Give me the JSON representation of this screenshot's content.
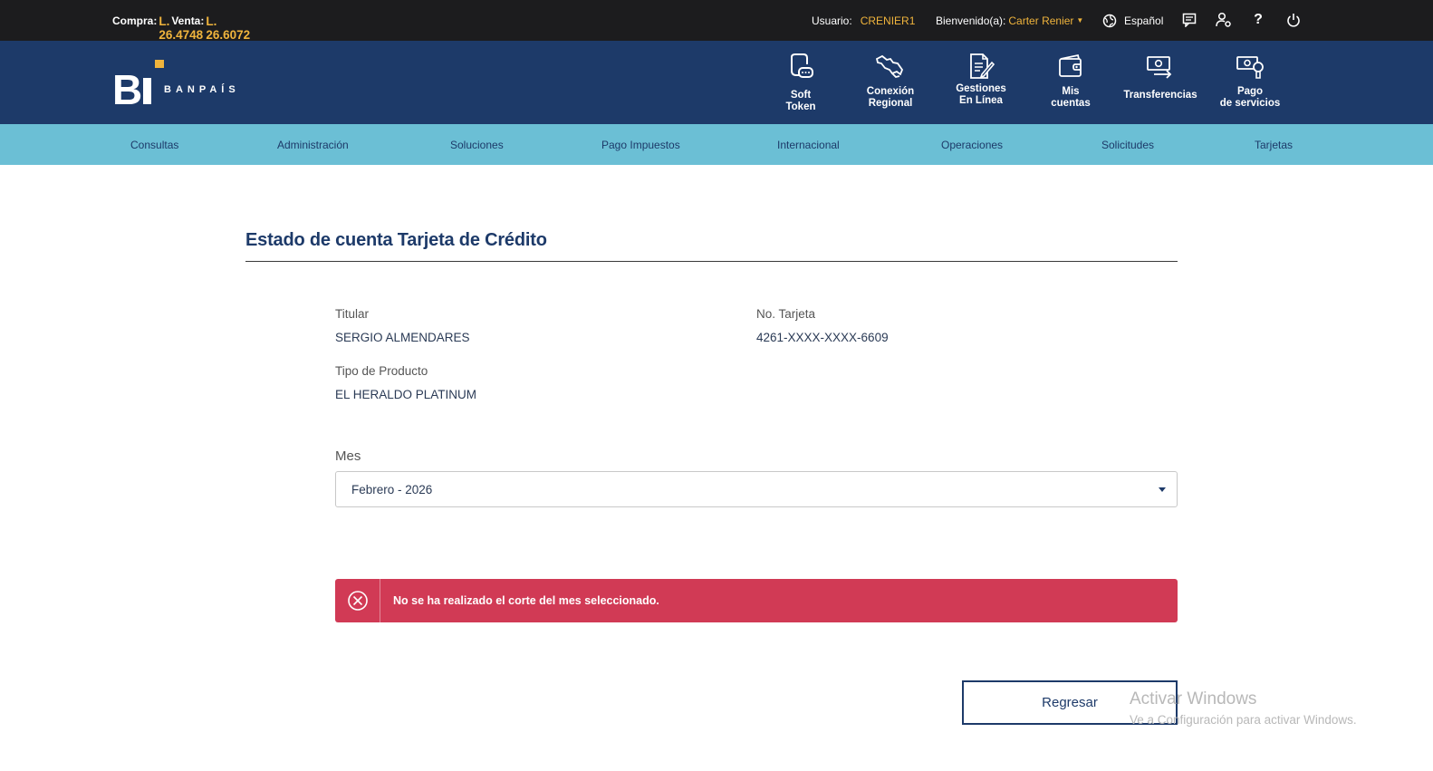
{
  "topbar": {
    "compra_label": "Compra:",
    "compra_value": "L. 26.4748",
    "venta_label": "Venta:",
    "venta_value": "L. 26.6072",
    "usuario_label": "Usuario:",
    "usuario_value": "CRENIER1",
    "bienvenido_label": "Bienvenido(a):",
    "bienvenido_value": "Carter Renier",
    "language": "Español",
    "help": "?"
  },
  "brand": {
    "logo_text": "BANPAÍS"
  },
  "quick_actions": [
    {
      "label": "Soft Token",
      "icon": "soft-token-icon"
    },
    {
      "label": "Conexión Regional",
      "icon": "map-icon"
    },
    {
      "label": "Gestiones En Línea",
      "icon": "document-edit-icon"
    },
    {
      "label": "Mis cuentas",
      "icon": "wallet-icon"
    },
    {
      "label": "Transferencias",
      "icon": "transfer-icon"
    },
    {
      "label": "Pago de servicios",
      "icon": "service-payment-icon"
    }
  ],
  "nav": [
    "Consultas",
    "Administración",
    "Soluciones",
    "Pago Impuestos",
    "Internacional",
    "Operaciones",
    "Solicitudes",
    "Tarjetas"
  ],
  "main": {
    "title": "Estado de cuenta Tarjeta de Crédito",
    "titular_label": "Titular",
    "titular_value": "SERGIO ALMENDARES",
    "tarjeta_label": "No. Tarjeta",
    "tarjeta_value": "4261-XXXX-XXXX-6609",
    "producto_label": "Tipo de Producto",
    "producto_value": "EL HERALDO PLATINUM",
    "mes_label": "Mes",
    "mes_value": "Febrero - 2026",
    "alert_message": "No se ha realizado el corte del mes seleccionado.",
    "back_button": "Regresar"
  },
  "watermark": {
    "line1": "Activar Windows",
    "line2": "Ve a Configuración para activar Windows."
  },
  "colors": {
    "topbar": "#1c1c1e",
    "brand": "#1d3a69",
    "nav": "#6bbfd5",
    "accent": "#f0b43c",
    "alert": "#d13a55"
  }
}
